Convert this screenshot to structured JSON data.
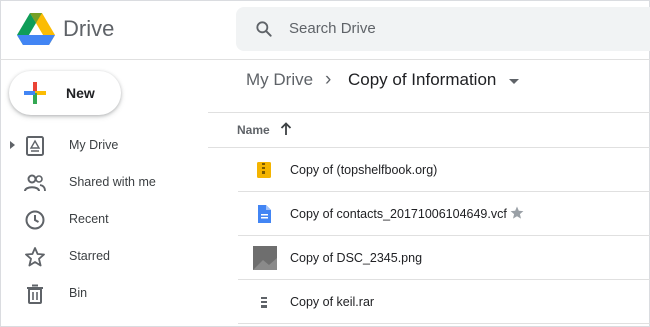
{
  "app": {
    "title": "Drive"
  },
  "search": {
    "placeholder": "Search Drive"
  },
  "sidebar": {
    "new_label": "New",
    "items": [
      {
        "label": "My Drive",
        "icon": "my-drive-icon"
      },
      {
        "label": "Shared with me",
        "icon": "shared-icon"
      },
      {
        "label": "Recent",
        "icon": "clock-icon"
      },
      {
        "label": "Starred",
        "icon": "star-icon"
      },
      {
        "label": "Bin",
        "icon": "trash-icon"
      }
    ]
  },
  "breadcrumb": {
    "root": "My Drive",
    "separator": "›",
    "current": "Copy of Information"
  },
  "list": {
    "header": {
      "name": "Name",
      "sort": "ascending"
    },
    "files": [
      {
        "name": "Copy of (topshelfbook.org)",
        "icon": "archive-yellow-icon",
        "starred": false
      },
      {
        "name": "Copy of contacts_20171006104649.vcf",
        "icon": "doc-blue-icon",
        "starred": true
      },
      {
        "name": "Copy of DSC_2345.png",
        "icon": "image-thumbnail",
        "starred": false
      },
      {
        "name": "Copy of keil.rar",
        "icon": "archive-gray-icon",
        "starred": false
      }
    ]
  },
  "colors": {
    "accent_blue": "#1a73e8",
    "text": "#3c4043",
    "muted": "#5f6368",
    "divider": "#e0e0e0"
  }
}
